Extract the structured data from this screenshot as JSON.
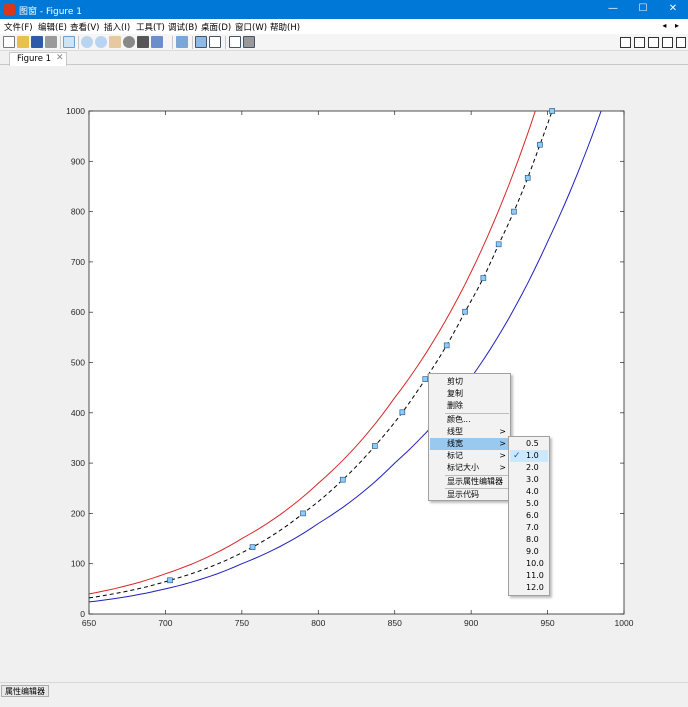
{
  "window": {
    "title": "图窗 - Figure 1",
    "minimize": "—",
    "maximize": "☐",
    "close": "✕"
  },
  "menubar": {
    "items": [
      "文件(F)",
      "编辑(E)",
      "查看(V)",
      "插入(I)",
      "工具(T)",
      "调试(B)",
      "桌面(D)",
      "窗口(W)",
      "帮助(H)"
    ],
    "right_arrows": "◂ ▸"
  },
  "toolbar": {
    "icons": [
      "new-file-icon",
      "open-folder-icon",
      "save-icon",
      "print-icon",
      "select-arrow-icon",
      "zoom-in-icon",
      "zoom-out-icon",
      "pan-hand-icon",
      "rotate-3d-icon",
      "data-cursor-icon",
      "brush-icon",
      "link-plot-icon",
      "colorbar-icon",
      "legend-icon",
      "hide-plot-tools-icon",
      "show-plot-tools-icon"
    ],
    "layout_icons": [
      "tile-grid-icon",
      "tile-columns-icon",
      "tile-rows-icon",
      "float-icon",
      "dock-icon"
    ]
  },
  "tabs": [
    {
      "label": "Figure 1",
      "close": "✕"
    }
  ],
  "chart_data": {
    "type": "line",
    "xlim": [
      650,
      1000
    ],
    "ylim": [
      0,
      1000
    ],
    "xticks": [
      "650",
      "700",
      "750",
      "800",
      "850",
      "900",
      "950",
      "1000"
    ],
    "yticks": [
      "0",
      "100",
      "200",
      "300",
      "400",
      "500",
      "600",
      "700",
      "800",
      "900",
      "1000"
    ],
    "grid": false,
    "series": [
      {
        "color": "#d62728",
        "style": "solid",
        "x": [
          650,
          700,
          750,
          800,
          850,
          900,
          942
        ],
        "y": [
          40,
          80,
          150,
          260,
          430,
          680,
          1000
        ]
      },
      {
        "color": "#000000",
        "style": "dashed",
        "markers": "square",
        "marker_color": "#8ecbff",
        "x": [
          650,
          703,
          757,
          790,
          816,
          837,
          855,
          870,
          884,
          896,
          908,
          918,
          928,
          937,
          945,
          953
        ],
        "y": [
          32,
          67,
          133,
          200,
          267,
          334,
          401,
          467,
          534,
          601,
          668,
          735,
          800,
          867,
          933,
          1000
        ]
      },
      {
        "color": "#1f1fbf",
        "style": "solid",
        "x": [
          650,
          700,
          750,
          800,
          850,
          900,
          950,
          985
        ],
        "y": [
          24,
          50,
          100,
          180,
          300,
          470,
          740,
          1000
        ]
      }
    ]
  },
  "context_menu": {
    "items": [
      {
        "label": "剪切",
        "submenu": false
      },
      {
        "label": "复制",
        "submenu": false
      },
      {
        "label": "删除",
        "submenu": false
      },
      {
        "label": "颜色...",
        "submenu": false
      },
      {
        "label": "线型",
        "submenu": true
      },
      {
        "label": "线宽",
        "submenu": true,
        "highlighted": true
      },
      {
        "label": "标记",
        "submenu": true
      },
      {
        "label": "标记大小",
        "submenu": true
      },
      {
        "label": "显示属性编辑器",
        "submenu": false
      },
      {
        "label": "显示代码",
        "submenu": false
      }
    ],
    "arrow": ">"
  },
  "linewidth_submenu": {
    "options": [
      "0.5",
      "1.0",
      "2.0",
      "3.0",
      "4.0",
      "5.0",
      "6.0",
      "7.0",
      "8.0",
      "9.0",
      "10.0",
      "11.0",
      "12.0"
    ],
    "selected_index": 1,
    "check": "✓"
  },
  "statusbar": {
    "property_editor_button": "属性编辑器"
  }
}
